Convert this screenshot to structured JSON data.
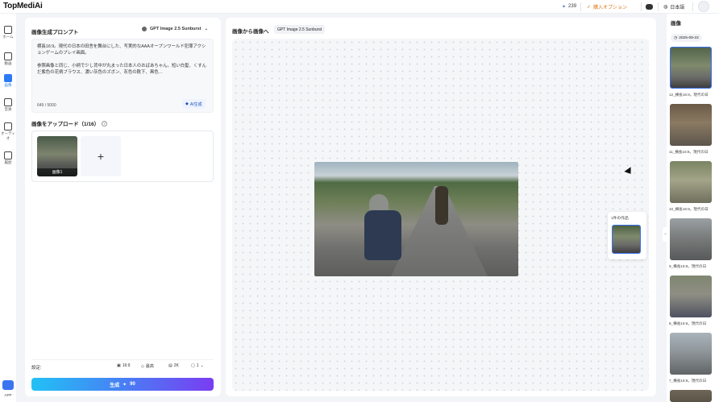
{
  "app": {
    "logo": "TopMediAi",
    "logo_mark": "®"
  },
  "topbar": {
    "credits": "239",
    "buy_label": "購入オプション",
    "language": "日本語"
  },
  "sidebar": {
    "items": [
      {
        "label": "ホーム",
        "icon": "home-icon"
      },
      {
        "label": "動画",
        "icon": "video-icon"
      },
      {
        "label": "画像",
        "icon": "image-icon",
        "active": true
      },
      {
        "label": "音楽",
        "icon": "music-icon"
      },
      {
        "label": "オーディオ",
        "icon": "audio-icon"
      },
      {
        "label": "履歴",
        "icon": "history-icon"
      }
    ],
    "app_label": "APP"
  },
  "left": {
    "prompt_title": "画像生成プロンプト",
    "model": "GPT Image 2.5 Sunburst",
    "prompt_text": "横長16:9。現代の日本の田舎を舞台にした、写実的なAAAオープンワールド犯罪アクションゲームのプレイ画面。\n\n参照画像と同じ、小柄で少し背中が丸まった日本人のおばあちゃん。短い白髪、くすんだ紫色の花柄ブラウス、濃い灰色のズボン、灰色の靴下、黒色…",
    "char_count": "649 / 5000",
    "ai_button": "AI生成",
    "upload_title": "画像をアップロード（1/16）",
    "thumb_label": "画像1",
    "add_symbol": "+",
    "settings_label": "設定:",
    "settings": {
      "ratio": "16:9",
      "quality": "最高",
      "resolution": "2K",
      "count": "1"
    },
    "generate_label": "生成",
    "generate_cost": "90"
  },
  "middle": {
    "title": "画像から画像へ",
    "model_chip": "GPT Image 2.5 Sunburst",
    "works_label": "1件の作品"
  },
  "right": {
    "title": "画像",
    "date": "2025-09-23",
    "captions": [
      "12_横長16:9。現代の日",
      "11_横長16:9。現代の日",
      "10_横長16:9。現代の日",
      "9_横長16:9。現代の日",
      "8_横長16:9。現代の日",
      "7_横長16:9。現代の日"
    ]
  },
  "colors": {
    "accent": "#2b7bf6",
    "buy": "#e07a1f",
    "gen_start": "#22c1f5",
    "gen_end": "#7a3df2"
  }
}
